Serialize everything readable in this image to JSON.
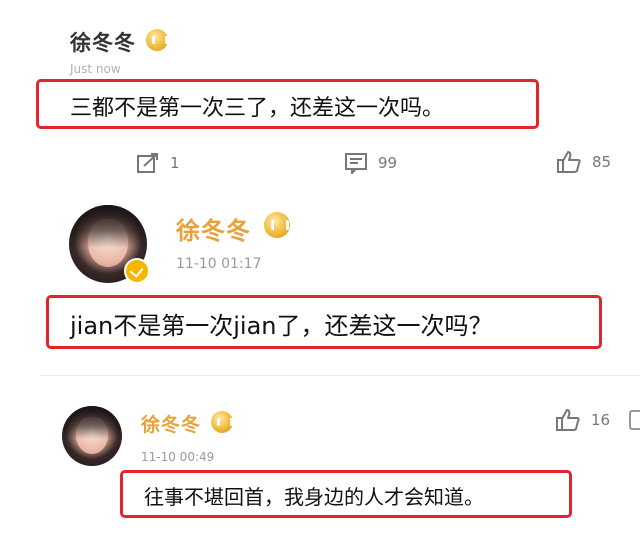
{
  "comment1": {
    "username": "徐冬冬",
    "time": "Just now",
    "text": "三都不是第一次三了，还差这一次吗。",
    "actions": {
      "share_count": "1",
      "reply_count": "99",
      "like_count": "85"
    }
  },
  "comment2": {
    "username": "徐冬冬",
    "time": "11-10 01:17",
    "text": "jian不是第一次jian了，还差这一次吗？"
  },
  "comment3": {
    "username": "徐冬冬",
    "time": "11-10 00:49",
    "text": "往事不堪回首，我身边的人才会知道。",
    "like_count": "16"
  },
  "colors": {
    "highlight_border": "#e3242b",
    "vip_gold": "#f1b93a",
    "meta_gray": "#9a9a9a"
  },
  "icons": [
    "vip-badge-icon",
    "share-icon",
    "comment-icon",
    "like-icon",
    "verified-badge-icon"
  ]
}
